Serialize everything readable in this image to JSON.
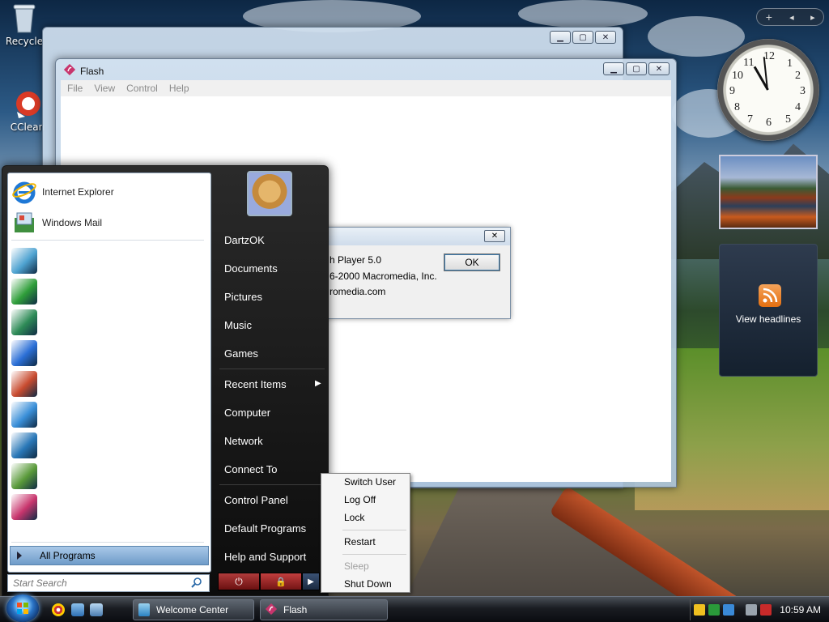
{
  "desktop": {
    "icons": [
      {
        "label": "Recycle",
        "icon": "recycle-bin-icon"
      },
      {
        "label": "CClean",
        "icon": "ccleaner-icon"
      }
    ]
  },
  "back_window": {
    "title": ""
  },
  "flash_window": {
    "title": "Flash",
    "menu": [
      "File",
      "View",
      "Control",
      "Help"
    ]
  },
  "about_dialog": {
    "lines": [
      "h Player 5.0",
      "6-2000 Macromedia, Inc.",
      "romedia.com"
    ],
    "ok_label": "OK"
  },
  "start_menu": {
    "pinned": [
      {
        "label": "Internet Explorer",
        "icon": "internet-explorer-icon",
        "color": "#1e78d6"
      },
      {
        "label": "Windows Mail",
        "icon": "windows-mail-icon",
        "color": "#3f8f3f"
      }
    ],
    "recent_icons": [
      {
        "icon": "welcome-center-icon",
        "color": "#4fa3d1"
      },
      {
        "icon": "windows-update-icon",
        "color": "#2f9e3a"
      },
      {
        "icon": "windows-media-center-icon",
        "color": "#2e8b57"
      },
      {
        "icon": "windows-media-player-icon",
        "color": "#2b6fd6"
      },
      {
        "icon": "windows-fax-scan-icon",
        "color": "#c84b2f"
      },
      {
        "icon": "windows-live-messenger-icon",
        "color": "#3a8fd8"
      },
      {
        "icon": "windows-dvd-maker-icon",
        "color": "#2a78b8"
      },
      {
        "icon": "paint-icon",
        "color": "#5a9a3a"
      },
      {
        "icon": "flash-icon",
        "color": "#c8356d"
      }
    ],
    "all_programs": "All Programs",
    "search_placeholder": "Start Search",
    "user_name": "DartzOK",
    "right_items": [
      "Documents",
      "Pictures",
      "Music",
      "Games",
      "Recent Items",
      "Computer",
      "Network",
      "Connect To",
      "Control Panel",
      "Default Programs",
      "Help and Support"
    ]
  },
  "power_menu": {
    "items": [
      {
        "label": "Switch User",
        "enabled": true
      },
      {
        "label": "Log Off",
        "enabled": true
      },
      {
        "label": "Lock",
        "enabled": true
      },
      {
        "label": "Restart",
        "enabled": true
      },
      {
        "label": "Sleep",
        "enabled": false
      },
      {
        "label": "Shut Down",
        "enabled": true
      }
    ]
  },
  "sidebar": {
    "feeds_label": "View headlines"
  },
  "taskbar": {
    "tasks": [
      {
        "label": "Welcome Center",
        "icon": "welcome-center-icon"
      },
      {
        "label": "Flash",
        "icon": "flash-icon"
      }
    ],
    "time": "10:59 AM"
  },
  "colors": {
    "accent": "#2b74c6",
    "all_programs_bg": "#6f9cc9",
    "power_red": "#b03b3b"
  }
}
